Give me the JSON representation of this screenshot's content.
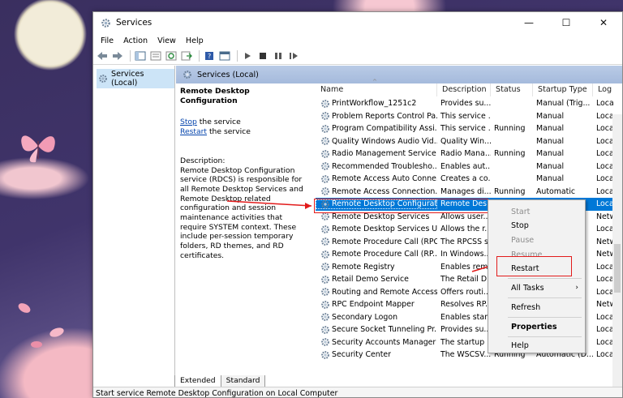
{
  "window": {
    "title": "Services"
  },
  "menu": [
    "File",
    "Action",
    "View",
    "Help"
  ],
  "tree": {
    "item": "Services (Local)"
  },
  "header": {
    "title": "Services (Local)"
  },
  "details": {
    "service_name": "Remote Desktop Configuration",
    "stop_link": "Stop",
    "stop_suffix": " the service",
    "restart_link": "Restart",
    "restart_suffix": " the service",
    "description_label": "Description:",
    "description_text": "Remote Desktop Configuration service (RDCS) is responsible for all Remote Desktop Services and Remote Desktop related configuration and session maintenance activities that require SYSTEM context. These include per-session temporary folders, RD themes, and RD certificates."
  },
  "columns": [
    "Name",
    "Description",
    "Status",
    "Startup Type",
    "Log"
  ],
  "rows": [
    {
      "name": "PrintWorkflow_1251c2",
      "desc": "Provides su...",
      "status": "",
      "startup": "Manual (Trig...",
      "log": "Loca"
    },
    {
      "name": "Problem Reports Control Pa...",
      "desc": "This service ...",
      "status": "",
      "startup": "Manual",
      "log": "Loca"
    },
    {
      "name": "Program Compatibility Assi...",
      "desc": "This service ...",
      "status": "Running",
      "startup": "Manual",
      "log": "Loca"
    },
    {
      "name": "Quality Windows Audio Vid...",
      "desc": "Quality Win...",
      "status": "",
      "startup": "Manual",
      "log": "Loca"
    },
    {
      "name": "Radio Management Service",
      "desc": "Radio Mana...",
      "status": "Running",
      "startup": "Manual",
      "log": "Loca"
    },
    {
      "name": "Recommended Troublesho...",
      "desc": "Enables aut...",
      "status": "",
      "startup": "Manual",
      "log": "Loca"
    },
    {
      "name": "Remote Access Auto Conne...",
      "desc": "Creates a co...",
      "status": "",
      "startup": "Manual",
      "log": "Loca"
    },
    {
      "name": "Remote Access Connection...",
      "desc": "Manages di...",
      "status": "Running",
      "startup": "Automatic",
      "log": "Loca"
    },
    {
      "name": "Remote Desktop Configurat...",
      "desc": "Remote Des...",
      "status": "",
      "startup": "",
      "log": "Loca"
    },
    {
      "name": "Remote Desktop Services",
      "desc": "Allows user...",
      "status": "",
      "startup": "",
      "log": "Netw"
    },
    {
      "name": "Remote Desktop Services U...",
      "desc": "Allows the r...",
      "status": "",
      "startup": "",
      "log": "Loca"
    },
    {
      "name": "Remote Procedure Call (RPC)",
      "desc": "The RPCSS s...",
      "status": "",
      "startup": "",
      "log": "Netw"
    },
    {
      "name": "Remote Procedure Call (RP...",
      "desc": "In Windows...",
      "status": "",
      "startup": "",
      "log": "Netw"
    },
    {
      "name": "Remote Registry",
      "desc": "Enables rem...",
      "status": "",
      "startup": "",
      "log": "Loca"
    },
    {
      "name": "Retail Demo Service",
      "desc": "The Retail D...",
      "status": "",
      "startup": "",
      "log": "Loca"
    },
    {
      "name": "Routing and Remote Access",
      "desc": "Offers routi...",
      "status": "",
      "startup": "",
      "log": "Loca"
    },
    {
      "name": "RPC Endpoint Mapper",
      "desc": "Resolves RP...",
      "status": "",
      "startup": "",
      "log": "Netw"
    },
    {
      "name": "Secondary Logon",
      "desc": "Enables star...",
      "status": "",
      "startup": "",
      "log": "Loca"
    },
    {
      "name": "Secure Socket Tunneling Pr...",
      "desc": "Provides su...",
      "status": "",
      "startup": "",
      "log": "Loca"
    },
    {
      "name": "Security Accounts Manager",
      "desc": "The startup ...",
      "status": "",
      "startup": "",
      "log": "Loca"
    },
    {
      "name": "Security Center",
      "desc": "The WSCSV...",
      "status": "Running",
      "startup": "Automatic (D...",
      "log": "Loca"
    }
  ],
  "context_menu": {
    "start": "Start",
    "stop": "Stop",
    "pause": "Pause",
    "resume": "Resume",
    "restart": "Restart",
    "all_tasks": "All Tasks",
    "refresh": "Refresh",
    "properties": "Properties",
    "help": "Help"
  },
  "tabs": [
    "Extended",
    "Standard"
  ],
  "status_bar": "Start service Remote Desktop Configuration on Local Computer",
  "colors": {
    "selection": "#0078d7",
    "highlight_box": "#e21b1b",
    "header_band": "#b9cbe6"
  }
}
